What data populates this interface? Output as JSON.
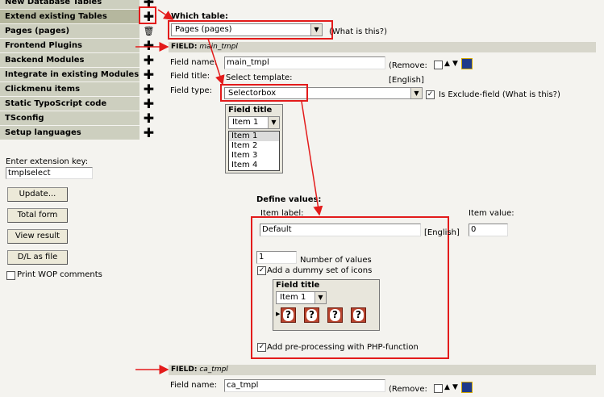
{
  "sidebar": {
    "items": [
      {
        "label": "New Database Tables",
        "icon": "plus-icon"
      },
      {
        "label": "Extend existing Tables",
        "icon": "plus-icon"
      },
      {
        "label": "Pages (pages)",
        "icon": "trash-icon"
      },
      {
        "label": "Frontend Plugins",
        "icon": "plus-icon"
      },
      {
        "label": "Backend Modules",
        "icon": "plus-icon"
      },
      {
        "label": "Integrate in existing Modules",
        "icon": "plus-icon"
      },
      {
        "label": "Clickmenu items",
        "icon": "plus-icon"
      },
      {
        "label": "Static TypoScript code",
        "icon": "plus-icon"
      },
      {
        "label": "TSconfig",
        "icon": "plus-icon"
      },
      {
        "label": "Setup languages",
        "icon": "plus-icon"
      }
    ],
    "ext_key_label": "Enter extension key:",
    "ext_key_value": "tmplselect",
    "buttons": {
      "update": "Update...",
      "total_form": "Total form",
      "view_result": "View result",
      "dl_file": "D/L as file"
    },
    "print_wop": "Print WOP comments"
  },
  "which_table": {
    "label": "Which table:",
    "value": "Pages (pages)",
    "help": "(What is this?)"
  },
  "field1": {
    "bar_prefix": "FIELD:",
    "bar_name": "main_tmpl",
    "name_label": "Field name:",
    "name_value": "main_tmpl",
    "remove_label": "(Remove:",
    "title_label": "Field title:",
    "title_value": "Select template:",
    "lang": "[English]",
    "type_label": "Field type:",
    "type_value": "Selectorbox",
    "exclude_label": "Is Exclude-field",
    "exclude_help": "(What is this?)"
  },
  "preview1": {
    "title": "Field title",
    "select_value": "Item 1",
    "options": [
      "Item 1",
      "Item 2",
      "Item 3",
      "Item 4"
    ]
  },
  "define_values": {
    "label": "Define values:",
    "item_label_header": "Item label:",
    "item_value_header": "Item value:",
    "item_label_value": "Default",
    "lang": "[English]",
    "item_value_value": "0",
    "num_values": "1",
    "num_values_label": "Number of values",
    "dummy_icons_label": "Add a dummy set of icons",
    "preview_title": "Field title",
    "preview_select": "Item 1",
    "preprocessing_label": "Add pre-processing with PHP-function"
  },
  "field2": {
    "bar_prefix": "FIELD:",
    "bar_name": "ca_tmpl",
    "name_label": "Field name:",
    "name_value": "ca_tmpl",
    "remove_label": "(Remove:"
  },
  "colors": {
    "annotation_red": "#e31b1b",
    "sidebar_bg": "#cdcfbf",
    "background": "#f4f3ef"
  }
}
